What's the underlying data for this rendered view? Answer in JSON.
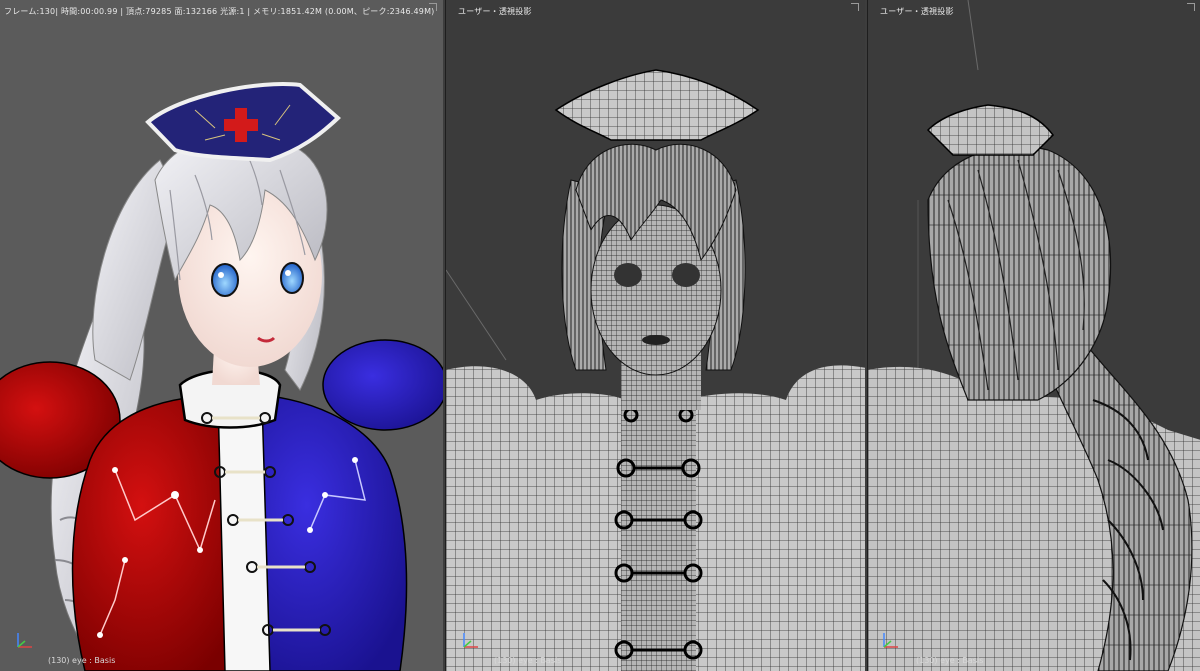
{
  "viewport_left": {
    "stats_label": "フレーム:130| 時間:00:00.99 | 頂点:79285 面:132166 光源:1 | メモリ:1851.42M (0.00M、ピーク:2346.49M)",
    "footer_label": "(130) eye : Basis",
    "mode": "rendered"
  },
  "viewport_center": {
    "view_label": "ユーザー・透視投影",
    "footer_label": "(130) eye : Basis",
    "mode": "wireframe-front"
  },
  "viewport_right": {
    "view_label": "ユーザー・透視投影",
    "footer_label": "(130) eye : Basis",
    "mode": "wireframe-back"
  },
  "colors": {
    "viewport_bg_rendered": "#5b5b5b",
    "viewport_bg_solid": "#3b3b3b",
    "hair": "#d9d9de",
    "dress_red": "#c00000",
    "dress_blue": "#2a1ec8",
    "hat_navy": "#2a2a8a",
    "cross_red": "#d31a1a",
    "eye_blue": "#2a7ae0",
    "mesh_surface": "#bdbdbd",
    "wire": "#1a1a1a"
  },
  "icons": {
    "axis": "axis-gizmo-icon",
    "corner": "viewport-corner-icon"
  }
}
